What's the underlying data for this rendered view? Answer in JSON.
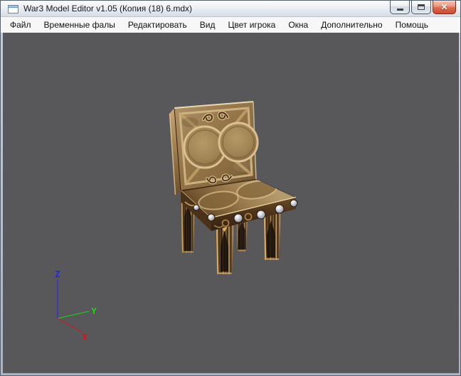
{
  "window": {
    "title": "War3 Model Editor v1.05 (Копия (18) 6.mdx)",
    "controls": {
      "close_glyph": "✕"
    }
  },
  "menu": {
    "items": [
      {
        "label": "Файл"
      },
      {
        "label": "Временные фалы"
      },
      {
        "label": "Редактировать"
      },
      {
        "label": "Вид"
      },
      {
        "label": "Цвет игрока"
      },
      {
        "label": "Окна"
      },
      {
        "label": "Дополнительно"
      },
      {
        "label": "Помощь"
      }
    ]
  },
  "viewport": {
    "background_color": "#58585a",
    "model_description": "ornate wooden chair 3D model",
    "axis_gizmo": {
      "x": {
        "label": "X",
        "color": "#e01212"
      },
      "y": {
        "label": "Y",
        "color": "#16d916"
      },
      "z": {
        "label": "Z",
        "color": "#2424ee"
      }
    },
    "palette": {
      "wood_light": "#cdb283",
      "wood_mid": "#96764a",
      "wood_dark": "#4a3119",
      "stud_silver": "#d9dae2"
    }
  }
}
